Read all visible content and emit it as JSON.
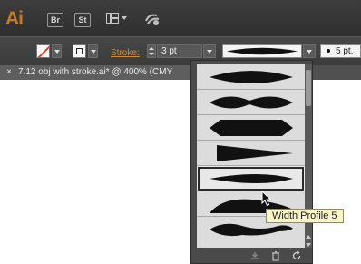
{
  "app": {
    "logo": "Ai",
    "buttons": [
      "Br",
      "St"
    ]
  },
  "control_bar": {
    "stroke_label": "Stroke:",
    "stroke_weight": "3 pt",
    "point_value": "5 pt."
  },
  "document_tab": {
    "close_glyph": "×",
    "title": "7.12 obj with stroke.ai* @ 400% (CMY"
  },
  "profile_popup": {
    "profiles": [
      {
        "shape": "uniform-ellipse"
      },
      {
        "shape": "pinched-ellipse"
      },
      {
        "shape": "bulge-flat"
      },
      {
        "shape": "taper-triangle"
      },
      {
        "shape": "width-profile-5",
        "selected": true
      },
      {
        "shape": "dome-wave"
      },
      {
        "shape": "wave-taper"
      }
    ],
    "footer_icons": [
      "save-profile-icon",
      "delete-profile-icon",
      "reset-profiles-icon"
    ]
  },
  "tooltip": {
    "text": "Width Profile 5"
  }
}
